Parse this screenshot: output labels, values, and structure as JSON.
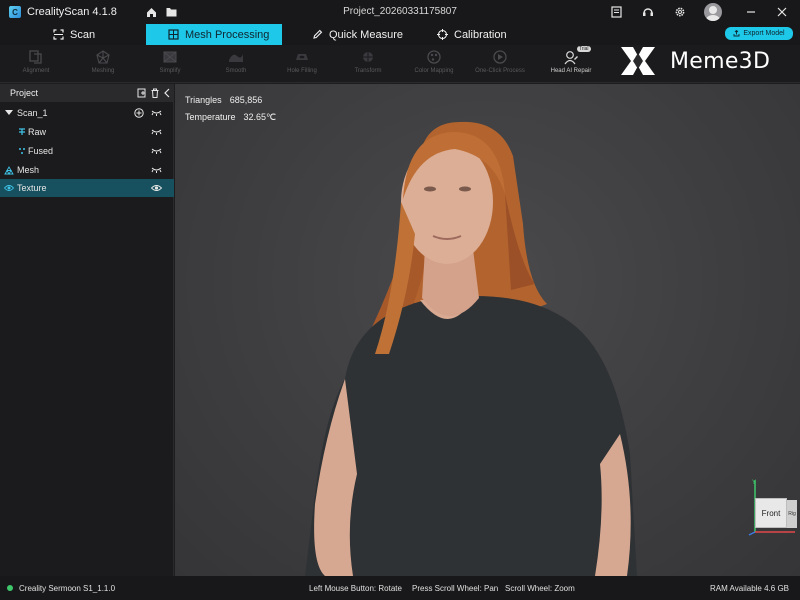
{
  "app": {
    "title": "CrealityScan 4.1.8",
    "project_name": "Project_20260331175807"
  },
  "tabs": [
    {
      "label": "Scan",
      "icon": "scan-icon"
    },
    {
      "label": "Mesh Processing",
      "icon": "mesh-processing-icon",
      "active": true
    },
    {
      "label": "Quick Measure",
      "icon": "pencil-icon"
    },
    {
      "label": "Calibration",
      "icon": "crosshair-icon"
    }
  ],
  "export_label": "Export Model",
  "toolbar": {
    "tools": [
      {
        "label": "Alignment",
        "icon": "alignment-icon",
        "enabled": false
      },
      {
        "label": "Meshing",
        "icon": "meshing-icon",
        "enabled": false
      },
      {
        "label": "Simplify",
        "icon": "simplify-icon",
        "enabled": false
      },
      {
        "label": "Smooth",
        "icon": "smooth-icon",
        "enabled": false
      },
      {
        "label": "Hole Filling",
        "icon": "hole-filling-icon",
        "enabled": false
      },
      {
        "label": "Transform",
        "icon": "transform-icon",
        "enabled": false
      },
      {
        "label": "Color Mapping",
        "icon": "color-mapping-icon",
        "enabled": false
      },
      {
        "label": "One-Click Process",
        "icon": "one-click-icon",
        "enabled": false
      },
      {
        "label": "Head AI Repair",
        "icon": "head-ai-repair-icon",
        "enabled": true,
        "badge": "Trial"
      }
    ]
  },
  "brand": {
    "name": "Meme3D"
  },
  "sidebar": {
    "title": "Project",
    "items": [
      {
        "label": "Scan_1",
        "icon": "caret-down-icon"
      },
      {
        "label": "Raw",
        "icon": "raw-points-icon"
      },
      {
        "label": "Fused",
        "icon": "fused-points-icon"
      },
      {
        "label": "Mesh",
        "icon": "mesh-icon"
      },
      {
        "label": "Texture",
        "icon": "eye-icon",
        "selected": true
      }
    ]
  },
  "viewport": {
    "triangles_label": "Triangles",
    "triangles_value": "685,856",
    "temperature_label": "Temperature",
    "temperature_value": "32.65℃",
    "view_cube_label": "Front",
    "view_cube_side": "Rig"
  },
  "status": {
    "device": "Creality Sermoon S1_1.1.0",
    "hint_left": "Left Mouse Button: Rotate",
    "hint_scroll_btn": "Press Scroll Wheel: Pan",
    "hint_scroll": "Scroll Wheel: Zoom",
    "ram": "RAM Available 4.6 GB"
  },
  "colors": {
    "accent": "#1ec8e8",
    "selected_row": "#17505e",
    "background": "#1b1b1d",
    "viewport": "#3e3e40",
    "status_dot": "#3ec86b"
  }
}
